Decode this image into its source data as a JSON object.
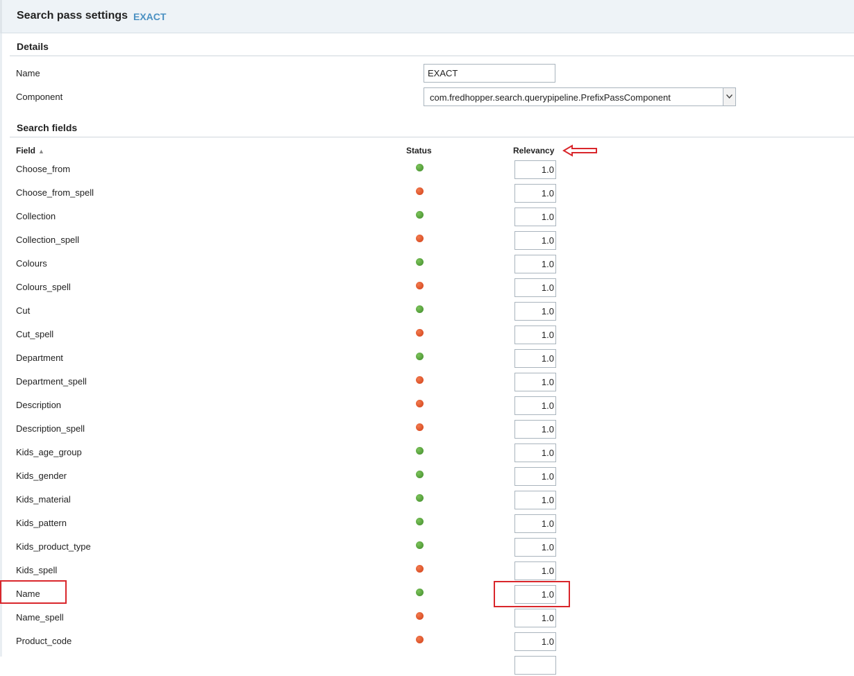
{
  "header": {
    "title": "Search pass settings",
    "pass_name": "EXACT"
  },
  "details": {
    "section_title": "Details",
    "name_label": "Name",
    "name_value": "EXACT",
    "component_label": "Component",
    "component_value": "com.fredhopper.search.querypipeline.PrefixPassComponent"
  },
  "search_fields": {
    "section_title": "Search fields",
    "columns": {
      "field": "Field",
      "status": "Status",
      "relevancy": "Relevancy"
    },
    "sort_indicator": "ascending",
    "rows": [
      {
        "field": "Choose_from",
        "status": "active",
        "relevancy": "1.0"
      },
      {
        "field": "Choose_from_spell",
        "status": "inactive",
        "relevancy": "1.0"
      },
      {
        "field": "Collection",
        "status": "active",
        "relevancy": "1.0"
      },
      {
        "field": "Collection_spell",
        "status": "inactive",
        "relevancy": "1.0"
      },
      {
        "field": "Colours",
        "status": "active",
        "relevancy": "1.0"
      },
      {
        "field": "Colours_spell",
        "status": "inactive",
        "relevancy": "1.0"
      },
      {
        "field": "Cut",
        "status": "active",
        "relevancy": "1.0"
      },
      {
        "field": "Cut_spell",
        "status": "inactive",
        "relevancy": "1.0"
      },
      {
        "field": "Department",
        "status": "active",
        "relevancy": "1.0"
      },
      {
        "field": "Department_spell",
        "status": "inactive",
        "relevancy": "1.0"
      },
      {
        "field": "Description",
        "status": "inactive",
        "relevancy": "1.0"
      },
      {
        "field": "Description_spell",
        "status": "inactive",
        "relevancy": "1.0"
      },
      {
        "field": "Kids_age_group",
        "status": "active",
        "relevancy": "1.0"
      },
      {
        "field": "Kids_gender",
        "status": "active",
        "relevancy": "1.0"
      },
      {
        "field": "Kids_material",
        "status": "active",
        "relevancy": "1.0"
      },
      {
        "field": "Kids_pattern",
        "status": "active",
        "relevancy": "1.0"
      },
      {
        "field": "Kids_product_type",
        "status": "active",
        "relevancy": "1.0"
      },
      {
        "field": "Kids_spell",
        "status": "inactive",
        "relevancy": "1.0"
      },
      {
        "field": "Name",
        "status": "active",
        "relevancy": "1.0"
      },
      {
        "field": "Name_spell",
        "status": "inactive",
        "relevancy": "1.0"
      },
      {
        "field": "Product_code",
        "status": "inactive",
        "relevancy": "1.0"
      },
      {
        "field": "",
        "status": "",
        "relevancy": ""
      }
    ]
  },
  "colors": {
    "active": "#4a9a2f",
    "inactive": "#e0522a",
    "annotation": "#d9262b",
    "accent": "#4a90c2"
  },
  "annotations": {
    "arrow_icon": "left-arrow-outline-icon"
  }
}
